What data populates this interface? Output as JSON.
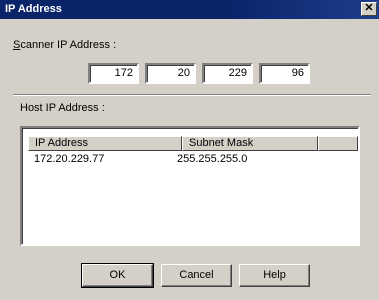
{
  "window": {
    "title": "IP Address",
    "close_glyph": "✕"
  },
  "scanner": {
    "label_accel": "S",
    "label_rest": "canner IP Address :",
    "octets": [
      "172",
      "20",
      "229",
      "96"
    ]
  },
  "host": {
    "label": "Host IP Address :",
    "columns": [
      "IP Address",
      "Subnet Mask"
    ],
    "rows": [
      {
        "ip": "172.20.229.77",
        "mask": "255.255.255.0"
      }
    ]
  },
  "buttons": {
    "ok": "OK",
    "cancel": "Cancel",
    "help": "Help"
  }
}
